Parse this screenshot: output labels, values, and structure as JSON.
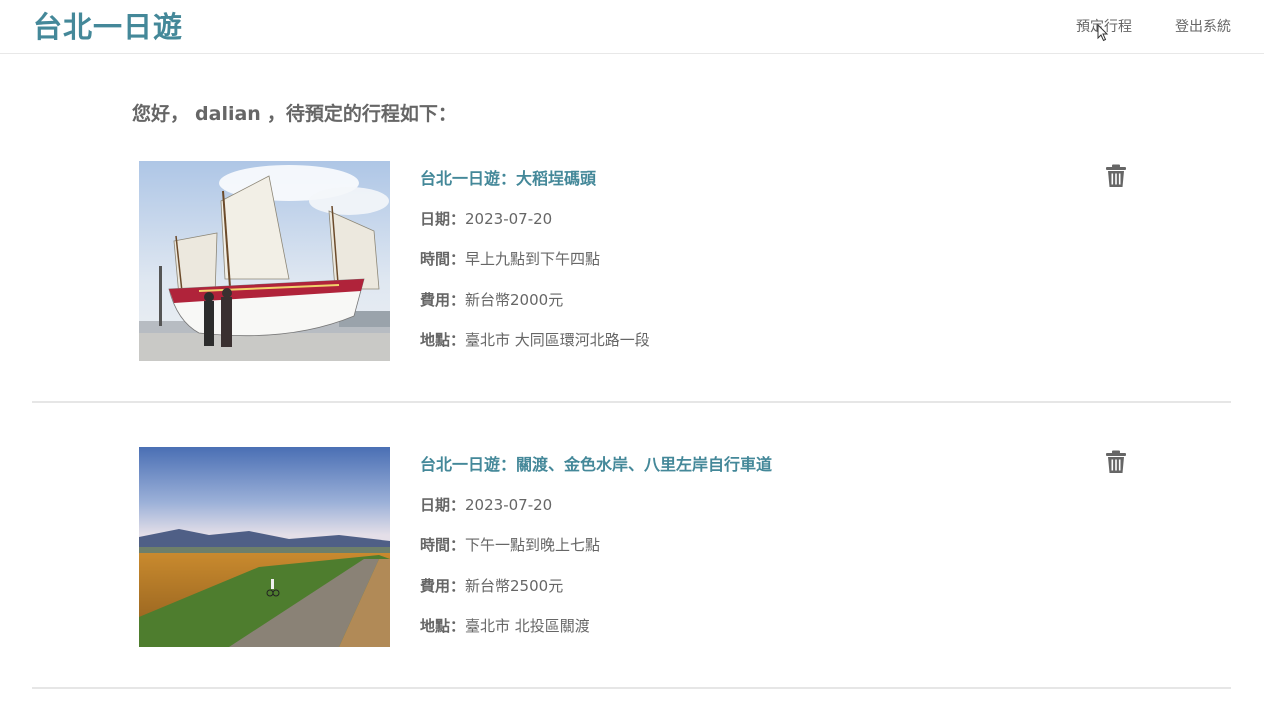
{
  "navbar": {
    "brand": "台北一日遊",
    "links": [
      "預定行程",
      "登出系統"
    ]
  },
  "greeting": {
    "prefix": "您好，",
    "username": "dalian",
    "suffix": "，待預定的行程如下："
  },
  "bookings": [
    {
      "title": "台北一日遊：大稻埕碼頭",
      "date_label": "日期：",
      "date": "2023-07-20",
      "time_label": "時間：",
      "time": "早上九點到下午四點",
      "fee_label": "費用：",
      "fee": "新台幣2000元",
      "place_label": "地點：",
      "place": "臺北市 大同區環河北路一段",
      "image": "sailing-junk-ship-photo"
    },
    {
      "title": "台北一日遊：關渡、金色水岸、八里左岸自行車道",
      "date_label": "日期：",
      "date": "2023-07-20",
      "time_label": "時間：",
      "time": "下午一點到晚上七點",
      "fee_label": "費用：",
      "fee": "新台幣2500元",
      "place_label": "地點：",
      "place": "臺北市 北投區關渡",
      "image": "bike-path-field-photo"
    }
  ],
  "icons": {
    "delete": "trash-icon",
    "cursor": "mouse-pointer-icon"
  },
  "colors": {
    "accent": "#448899",
    "text": "#666666",
    "divider": "#e6e6e6"
  }
}
